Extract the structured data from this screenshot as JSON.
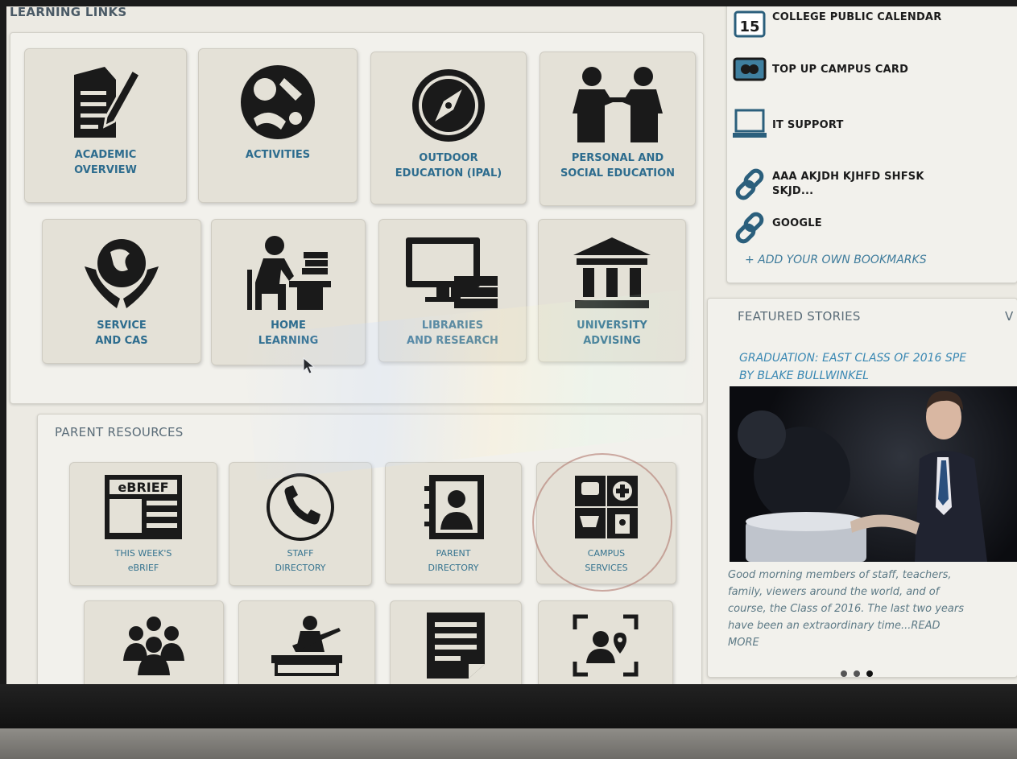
{
  "learning_links": {
    "title": "LEARNING LINKS",
    "tiles": [
      {
        "label": "ACADEMIC\nOVERVIEW",
        "icon": "document-pencil-icon"
      },
      {
        "label": "ACTIVITIES",
        "icon": "sports-icon"
      },
      {
        "label": "OUTDOOR\nEDUCATION (IPAL)",
        "icon": "compass-icon"
      },
      {
        "label": "PERSONAL AND\nSOCIAL EDUCATION",
        "icon": "people-talking-icon"
      },
      {
        "label": "SERVICE\nAND CAS",
        "icon": "globe-hands-icon"
      },
      {
        "label": "HOME\nLEARNING",
        "icon": "student-desk-icon"
      },
      {
        "label": "LIBRARIES\nAND RESEARCH",
        "icon": "computer-books-icon"
      },
      {
        "label": "UNIVERSITY\nADVISING",
        "icon": "university-icon"
      }
    ]
  },
  "parent_resources": {
    "title": "PARENT RESOURCES",
    "tiles": [
      {
        "label": "THIS WEEK'S\neBRIEF",
        "icon": "newsletter-icon",
        "icon_text": "eBRIEF"
      },
      {
        "label": "STAFF\nDIRECTORY",
        "icon": "phone-icon"
      },
      {
        "label": "PARENT\nDIRECTORY",
        "icon": "contact-book-icon"
      },
      {
        "label": "CAMPUS\nSERVICES",
        "icon": "campus-services-icon"
      },
      {
        "icon": "group-icon"
      },
      {
        "icon": "musician-icon"
      },
      {
        "icon": "form-icon"
      },
      {
        "icon": "location-profile-icon"
      }
    ]
  },
  "bookmarks": {
    "items": [
      {
        "label": "COLLEGE PUBLIC CALENDAR",
        "icon": "calendar-icon",
        "icon_text": "15"
      },
      {
        "label": "TOP UP CAMPUS CARD",
        "icon": "card-icon"
      },
      {
        "label": "IT SUPPORT",
        "icon": "laptop-icon"
      },
      {
        "label": "AAA AKJDH KJHFD SHFSK\nSKJD...",
        "icon": "link-icon"
      },
      {
        "label": "GOOGLE",
        "icon": "link-icon"
      }
    ],
    "add_label": "+ ADD YOUR OWN BOOKMARKS"
  },
  "featured": {
    "title": "FEATURED STORIES",
    "view_all": "V",
    "story_title": "GRADUATION: EAST CLASS OF 2016 SPE\nBY BLAKE BULLWINKEL",
    "story_text": "Good morning members of staff, teachers,\nfamily, viewers around the world, and of\ncourse, the Class of 2016. The last two years\nhave been an extraordinary time...READ\nMORE"
  },
  "colors": {
    "label_blue": "#2d6c8e",
    "tile_bg": "#e4e1d7",
    "link_blue": "#3a88b3"
  }
}
